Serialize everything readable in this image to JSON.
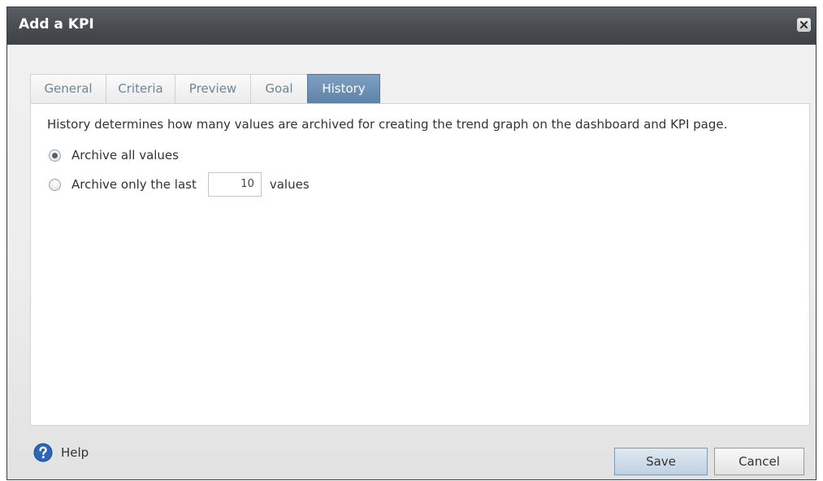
{
  "dialog": {
    "title": "Add a KPI"
  },
  "tabs": [
    {
      "label": "General",
      "active": false
    },
    {
      "label": "Criteria",
      "active": false
    },
    {
      "label": "Preview",
      "active": false
    },
    {
      "label": "Goal",
      "active": false
    },
    {
      "label": "History",
      "active": true
    }
  ],
  "history": {
    "description": "History determines how many values are archived for creating the trend graph on the dashboard and KPI page.",
    "option_all_label": "Archive all values",
    "option_all_selected": true,
    "option_last_prefix": "Archive only the last",
    "option_last_selected": false,
    "option_last_value": "10",
    "option_last_suffix": "values"
  },
  "footer": {
    "help_label": "Help",
    "save_label": "Save",
    "cancel_label": "Cancel"
  },
  "icons": {
    "close": "close-icon",
    "help": "help-icon"
  },
  "colors": {
    "titlebar": "#4a4e52",
    "active_tab": "#6a8db3",
    "tab_text": "#6d8699",
    "help_blue": "#2b66b8"
  }
}
